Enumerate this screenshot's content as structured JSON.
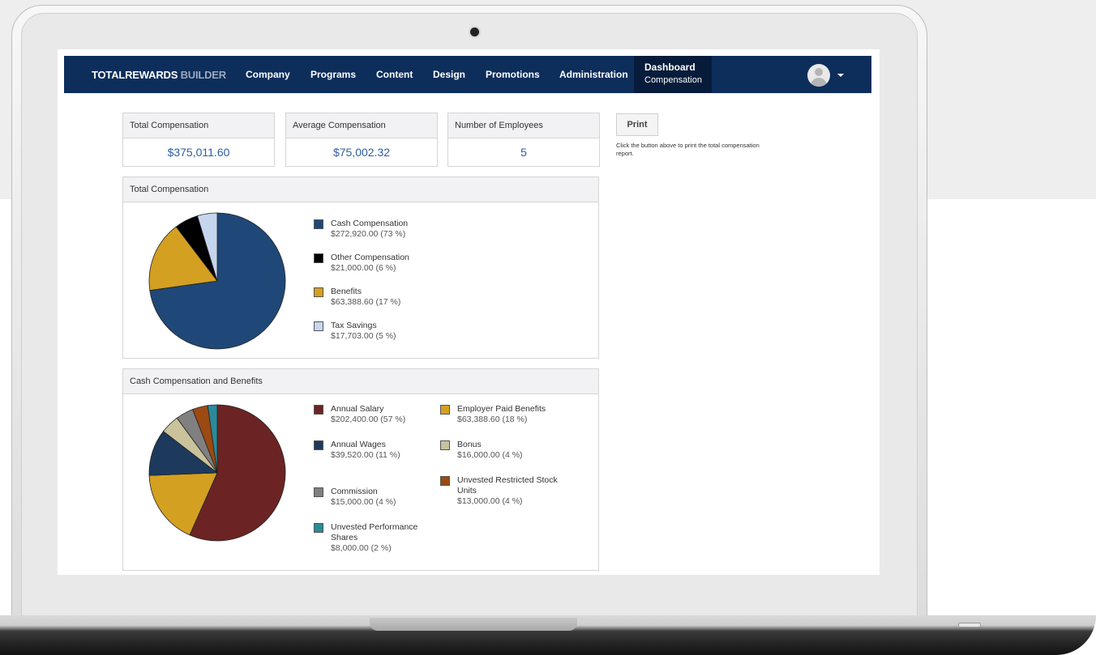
{
  "nav": {
    "brand_main": "TOTALREWARDS",
    "brand_sub": "BUILDER",
    "items": [
      "Company",
      "Programs",
      "Content",
      "Design",
      "Promotions",
      "Administration"
    ],
    "active_title": "Dashboard",
    "active_sub": "Compensation"
  },
  "stats": [
    {
      "label": "Total Compensation",
      "value": "$375,011.60"
    },
    {
      "label": "Average Compensation",
      "value": "$75,002.32"
    },
    {
      "label": "Number of Employees",
      "value": "5"
    }
  ],
  "print": {
    "button_label": "Print",
    "note": "Click the button above to print the total compensation report."
  },
  "panel1": {
    "title": "Total Compensation",
    "legend": [
      {
        "name": "Cash Compensation",
        "amount": "$272,920.00 (73 %)",
        "color": "#1f4878"
      },
      {
        "name": "Other Compensation",
        "amount": "$21,000.00 (6 %)",
        "color": "#000000"
      },
      {
        "name": "Benefits",
        "amount": "$63,388.60 (17 %)",
        "color": "#d4a021"
      },
      {
        "name": "Tax Savings",
        "amount": "$17,703.00 (5 %)",
        "color": "#c6d6ee"
      }
    ]
  },
  "panel2": {
    "title": "Cash Compensation and Benefits",
    "legend": [
      {
        "name": "Annual Salary",
        "amount": "$202,400.00 (57 %)",
        "color": "#6b2423"
      },
      {
        "name": "Employer Paid Benefits",
        "amount": "$63,388.60 (18 %)",
        "color": "#d4a021"
      },
      {
        "name": "Annual Wages",
        "amount": "$39,520.00 (11 %)",
        "color": "#1d3a5c"
      },
      {
        "name": "Bonus",
        "amount": "$16,000.00 (4 %)",
        "color": "#c9c29b"
      },
      {
        "name": "Commission",
        "amount": "$15,000.00 (4 %)",
        "color": "#808080"
      },
      {
        "name": "Unvested Restricted Stock Units",
        "amount": "$13,000.00 (4 %)",
        "color": "#9b4a12"
      },
      {
        "name": "Unvested Performance Shares",
        "amount": "$8,000.00 (2 %)",
        "color": "#2b8a9a"
      }
    ]
  },
  "chart_data": [
    {
      "type": "pie",
      "title": "Total Compensation",
      "categories": [
        "Cash Compensation",
        "Other Compensation",
        "Benefits",
        "Tax Savings"
      ],
      "values": [
        272920.0,
        21000.0,
        63388.6,
        17703.0
      ],
      "colors": [
        "#1f4878",
        "#000000",
        "#d4a021",
        "#c6d6ee"
      ],
      "slice_order": [
        0,
        2,
        1,
        3
      ]
    },
    {
      "type": "pie",
      "title": "Cash Compensation and Benefits",
      "categories": [
        "Annual Salary",
        "Employer Paid Benefits",
        "Annual Wages",
        "Bonus",
        "Commission",
        "Unvested Restricted Stock Units",
        "Unvested Performance Shares"
      ],
      "values": [
        202400.0,
        63388.6,
        39520.0,
        16000.0,
        15000.0,
        13000.0,
        8000.0
      ],
      "colors": [
        "#6b2423",
        "#d4a021",
        "#1d3a5c",
        "#c9c29b",
        "#808080",
        "#9b4a12",
        "#2b8a9a"
      ],
      "slice_order": [
        0,
        1,
        2,
        3,
        4,
        5,
        6
      ]
    }
  ]
}
